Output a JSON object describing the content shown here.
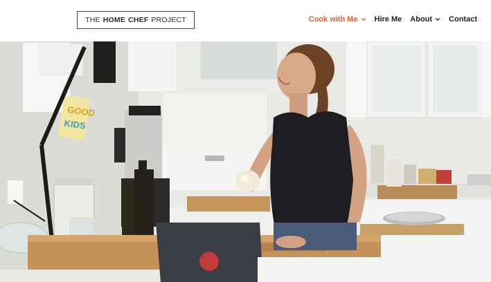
{
  "logo": {
    "words": [
      "THE",
      "HOME",
      "CHEF",
      "PROJECT"
    ]
  },
  "nav": {
    "items": [
      {
        "label": "Cook with Me",
        "has_dropdown": true,
        "active": true
      },
      {
        "label": "Hire Me",
        "has_dropdown": false,
        "active": false
      },
      {
        "label": "About",
        "has_dropdown": true,
        "active": false
      },
      {
        "label": "Contact",
        "has_dropdown": false,
        "active": false
      }
    ],
    "active_color": "#e85b35"
  },
  "hero": {
    "calendar_text": "GOOD",
    "calendar_text2": "KIDS"
  }
}
